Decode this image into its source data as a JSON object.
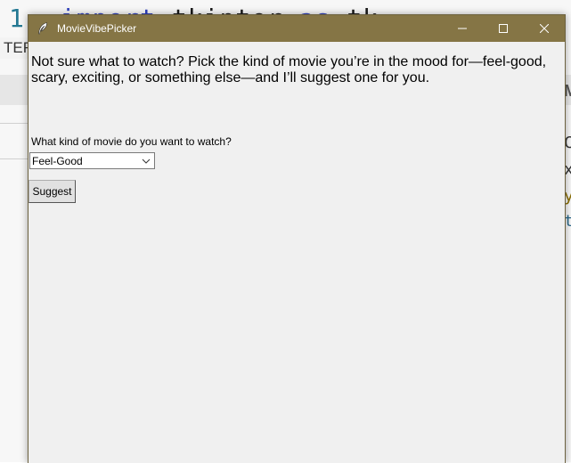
{
  "background": {
    "line_number": "1",
    "code_keyword_1": "import",
    "code_module": "tkinter",
    "code_keyword_2": "as",
    "code_alias": "tk",
    "left_tab_fragment": "TER",
    "right_fragment_1": "M",
    "right_fragment_2": "C",
    "right_fragment_3": "x",
    "right_fragment_4": "y",
    "right_fragment_5": "t"
  },
  "window": {
    "title": "MovieVibePicker",
    "icon": "feather-icon",
    "controls": [
      "minimize-icon",
      "maximize-icon",
      "close-icon"
    ]
  },
  "main": {
    "intro_text": "Not sure what to watch? Pick the kind of movie you’re in the mood for—feel-good, scary, exciting, or something else—and I’ll suggest one for you.",
    "prompt_label": "What kind of movie do you want to watch?",
    "genre_select": {
      "value": "Feel-Good"
    },
    "suggest_button": "Suggest"
  },
  "colors": {
    "titlebar": "#857545",
    "window_bg": "#f0f0f0",
    "button_bg": "#e1e1e1"
  }
}
